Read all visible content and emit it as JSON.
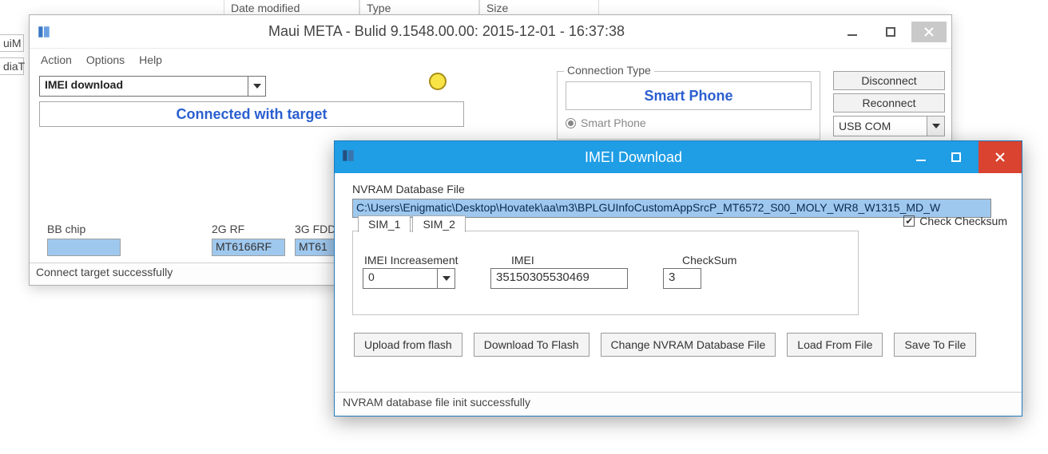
{
  "explorer_cols": {
    "date": "Date modified",
    "type": "Type",
    "size": "Size"
  },
  "left_clip": {
    "a": "uiM",
    "b": "diaT"
  },
  "main": {
    "title": "Maui META - Bulid 9.1548.00.00: 2015-12-01 - 16:37:38",
    "menu": {
      "action": "Action",
      "options": "Options",
      "help": "Help"
    },
    "function": "IMEI download",
    "target_status": "Connected with target",
    "conn": {
      "legend": "Connection Type",
      "device": "Smart Phone",
      "radio1": "Smart Phone"
    },
    "btn_disconnect": "Disconnect",
    "btn_reconnect": "Reconnect",
    "port_combo": "USB COM",
    "chips": {
      "bb_label": "BB chip",
      "bb_value": "",
      "rf2g_label": "2G RF",
      "rf2g_value": "MT6166RF",
      "rf3g_label": "3G FDD",
      "rf3g_value": "MT61"
    },
    "footer": "Connect target successfully"
  },
  "modal": {
    "title": "IMEI Download",
    "nvram_label": "NVRAM Database File",
    "nvram_path": "C:\\Users\\Enigmatic\\Desktop\\Hovatek\\aa\\m3\\BPLGUInfoCustomAppSrcP_MT6572_S00_MOLY_WR8_W1315_MD_W",
    "check_checksum": "Check Checksum",
    "check_checksum_on": true,
    "tabs": {
      "sim1": "SIM_1",
      "sim2": "SIM_2"
    },
    "labels": {
      "inc": "IMEI Increasement",
      "imei": "IMEI",
      "cksum": "CheckSum"
    },
    "values": {
      "inc": "0",
      "imei": "35150305530469",
      "cksum": "3"
    },
    "buttons": {
      "upload": "Upload from flash",
      "download": "Download To Flash",
      "change": "Change NVRAM Database File",
      "load": "Load From File",
      "save": "Save To File"
    },
    "footer": "NVRAM database file init successfully"
  }
}
